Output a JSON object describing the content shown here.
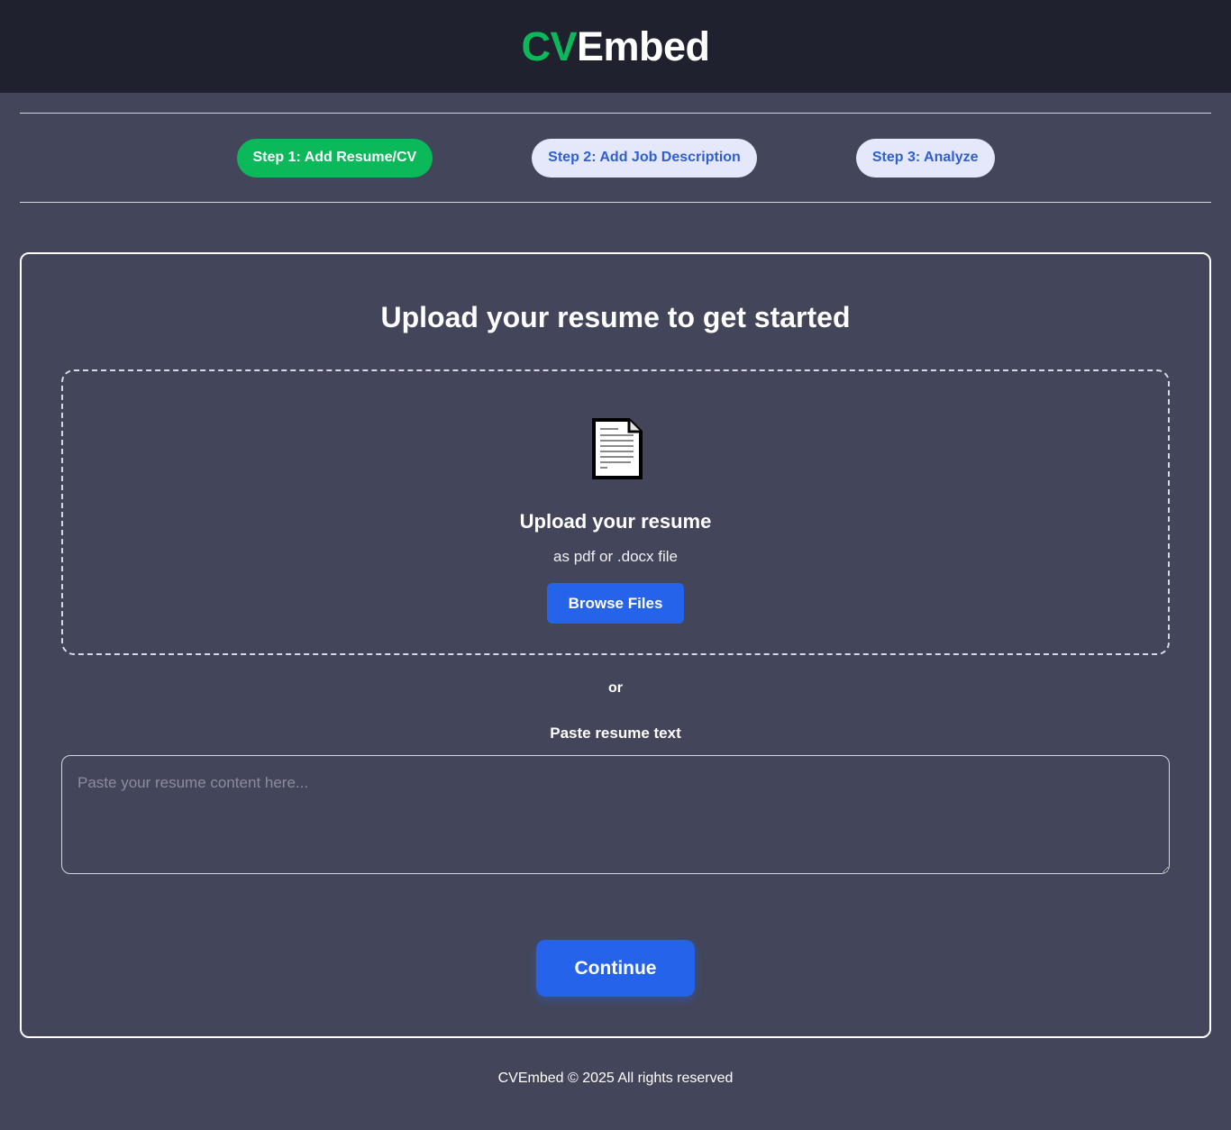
{
  "header": {
    "logo_accent": "CV",
    "logo_rest": "Embed",
    "accent_color": "#0bb85a",
    "background": "#20212e"
  },
  "steps": [
    {
      "label": "Step 1: Add Resume/CV",
      "active": true
    },
    {
      "label": "Step 2: Add Job Description",
      "active": false
    },
    {
      "label": "Step 3: Analyze",
      "active": false
    }
  ],
  "main": {
    "title": "Upload your resume to get started",
    "upload": {
      "icon": "document-icon",
      "title": "Upload your resume",
      "subtitle": "as pdf or .docx file",
      "browse_label": "Browse Files"
    },
    "or_text": "or",
    "paste": {
      "label": "Paste resume text",
      "placeholder": "Paste your resume content here...",
      "value": ""
    },
    "continue_label": "Continue"
  },
  "colors": {
    "page_bg": "#43465a",
    "primary_button": "#2563eb",
    "step_active": "#0bb85a",
    "step_inactive_bg": "#e5e8fa",
    "step_inactive_text": "#2f5fd0"
  },
  "footer": {
    "text": "CVEmbed © 2025 All rights reserved"
  }
}
